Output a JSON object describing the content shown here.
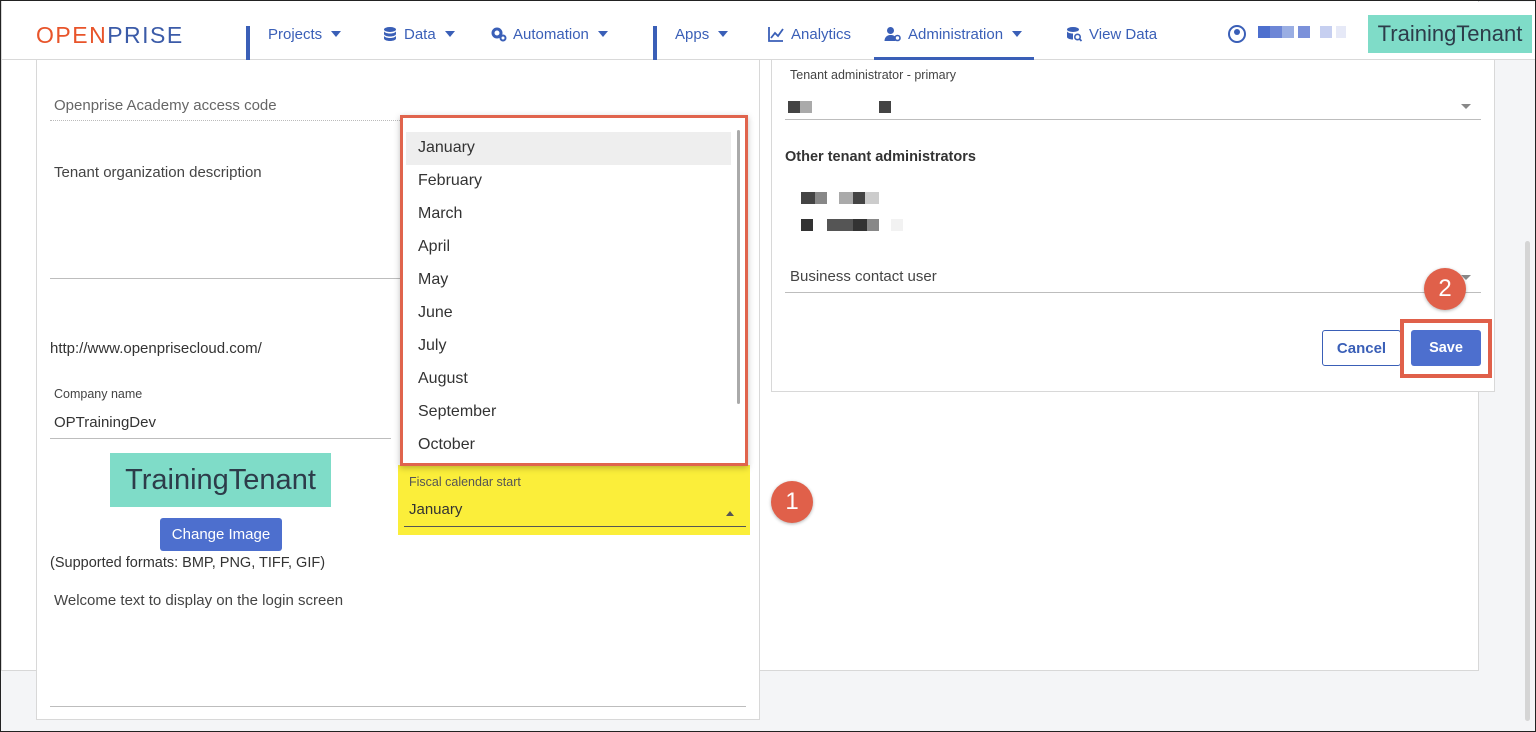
{
  "nav": {
    "logo_a": "OPEN",
    "logo_b": "PRISE",
    "items": [
      {
        "label": "Projects",
        "icon": "grid-icon"
      },
      {
        "label": "Data",
        "icon": "database-icon"
      },
      {
        "label": "Automation",
        "icon": "gears-icon"
      },
      {
        "label": "Apps",
        "icon": "grid-icon"
      },
      {
        "label": "Analytics",
        "icon": "chart-icon"
      },
      {
        "label": "Administration",
        "icon": "user-gear-icon"
      },
      {
        "label": "View Data",
        "icon": "database-search-icon"
      }
    ],
    "tenant_badge": "TrainingTenant"
  },
  "left": {
    "academy_label": "Openprise Academy access code",
    "description_label": "Tenant organization description",
    "website": "http://www.openprisecloud.com/",
    "company_label": "Company name",
    "company_value": "OPTrainingDev",
    "tenant_image_text": "TrainingTenant",
    "change_image_label": "Change Image",
    "formats_note": "(Supported formats: BMP, PNG, TIFF, GIF)",
    "welcome_label": "Welcome text to display on the login screen"
  },
  "fiscal": {
    "label": "Fiscal calendar start",
    "value": "January",
    "options": [
      "January",
      "February",
      "March",
      "April",
      "May",
      "June",
      "July",
      "August",
      "September",
      "October"
    ]
  },
  "right": {
    "primary_admin_label": "Tenant administrator - primary",
    "other_admins_label": "Other tenant administrators",
    "business_contact_label": "Business contact user",
    "cancel_label": "Cancel",
    "save_label": "Save"
  },
  "steps": {
    "one": "1",
    "two": "2"
  },
  "colors": {
    "accent": "#3a5fb7",
    "highlight": "#fbee3a",
    "callout": "#e0604a",
    "badge": "#7fdcc8"
  }
}
